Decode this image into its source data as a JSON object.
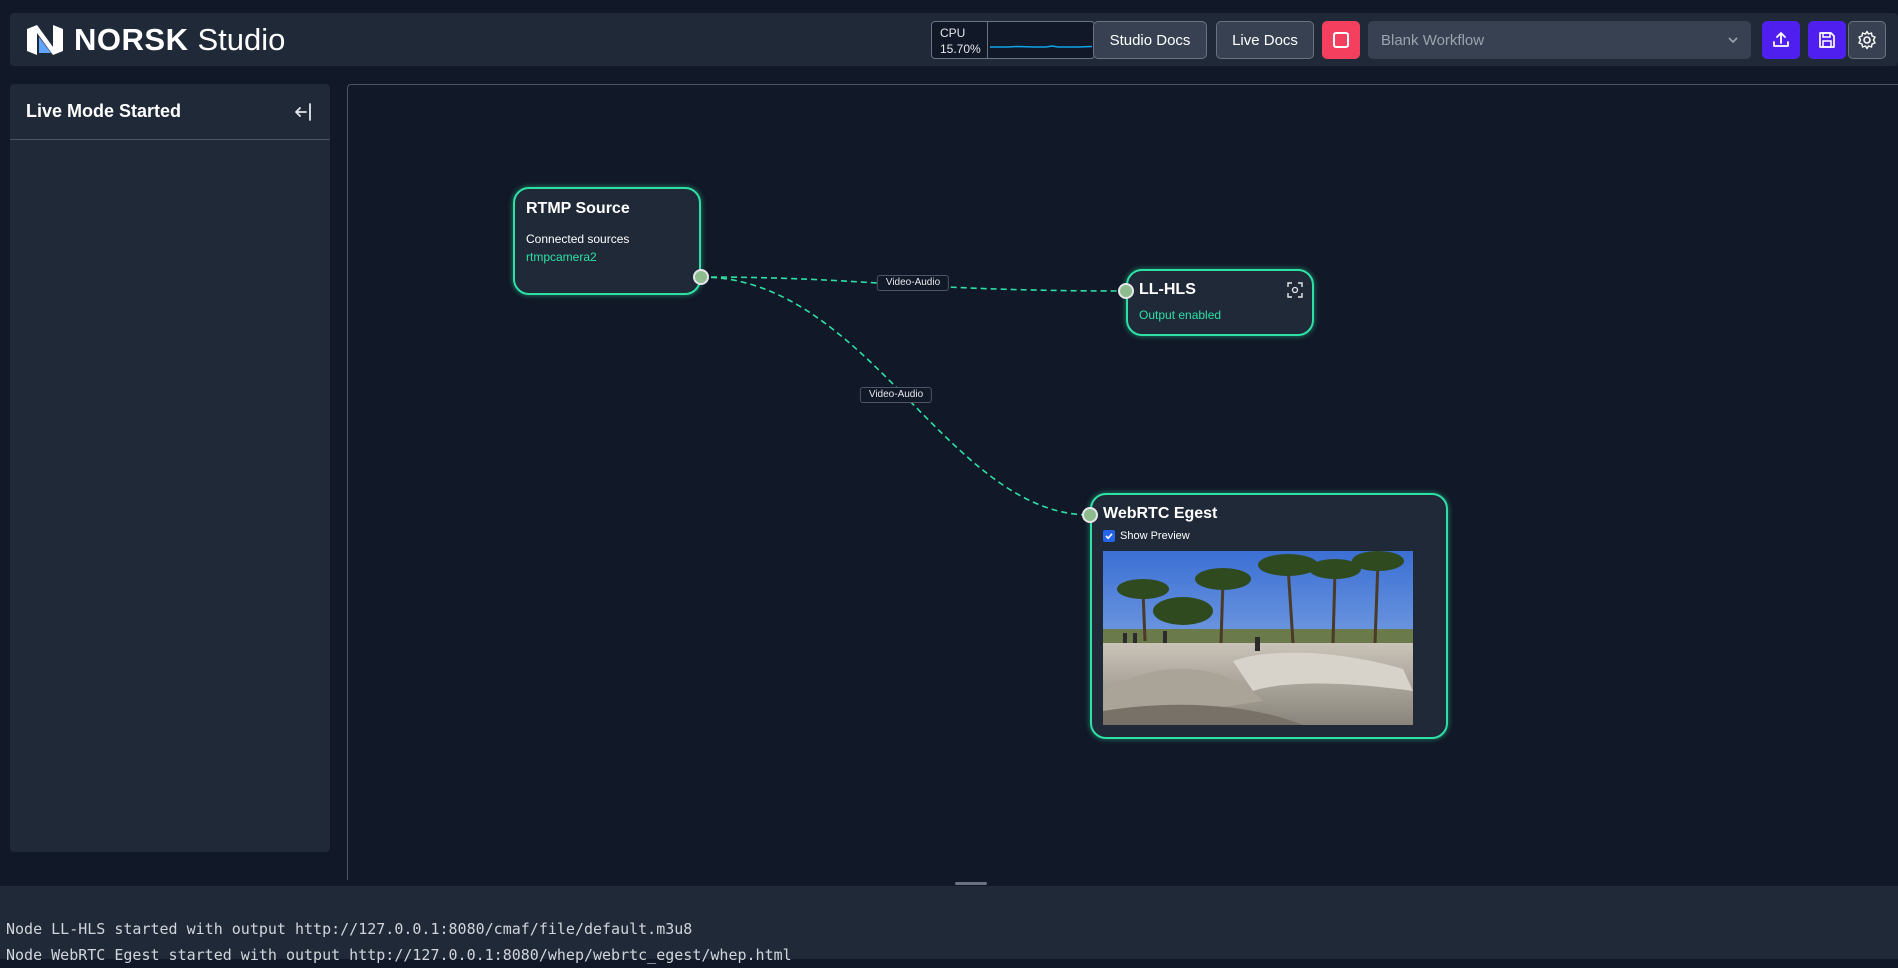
{
  "header": {
    "logo_word": "NORSK",
    "logo_app": "Studio",
    "cpu_label": "CPU",
    "cpu_value": "15.70%",
    "studio_docs_label": "Studio Docs",
    "live_docs_label": "Live Docs",
    "workflow_placeholder": "Blank Workflow"
  },
  "sidebar": {
    "title": "Live Mode Started"
  },
  "canvas": {
    "nodes": {
      "rtmp": {
        "title": "RTMP Source",
        "connected_label": "Connected sources",
        "source_name": "rtmpcamera2"
      },
      "llhls": {
        "title": "LL-HLS",
        "status": "Output enabled"
      },
      "webrtc": {
        "title": "WebRTC Egest",
        "show_preview_label": "Show Preview",
        "show_preview_checked": true
      }
    },
    "edges": [
      {
        "label": "Video-Audio"
      },
      {
        "label": "Video-Audio"
      }
    ]
  },
  "logs": [
    "Node LL-HLS started with output http://127.0.0.1:8080/cmaf/file/default.m3u8",
    "Node WebRTC Egest started with output http://127.0.0.1:8080/whep/webrtc_egest/whep.html"
  ],
  "colors": {
    "accent_green": "#2ee0a4",
    "brand_purple": "#4f1ff0",
    "stop_red": "#f43f5e",
    "background": "#111827",
    "panel": "#1f2937"
  }
}
